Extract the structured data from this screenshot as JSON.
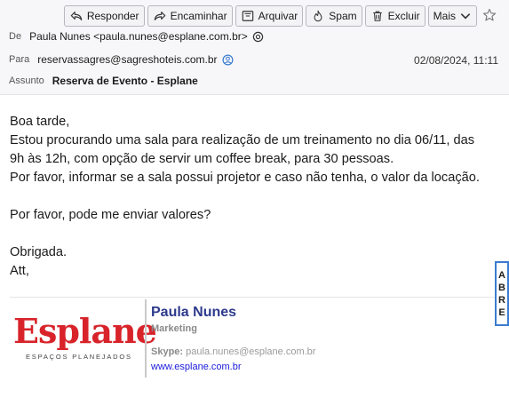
{
  "toolbar": {
    "reply": "Responder",
    "forward": "Encaminhar",
    "archive": "Arquivar",
    "spam": "Spam",
    "delete": "Excluir",
    "more": "Mais"
  },
  "header": {
    "from_label": "De",
    "from_value": "Paula Nunes <paula.nunes@esplane.com.br>",
    "to_label": "Para",
    "to_value": "reservassagres@sagreshoteis.com.br",
    "date": "02/08/2024, 11:11",
    "subject_label": "Assunto",
    "subject_value": "Reserva de Evento - Esplane"
  },
  "body": {
    "line1": "Boa tarde,",
    "line2": "Estou procurando uma sala para realização de um treinamento no dia 06/11, das",
    "line3": "9h às 12h, com opção de servir um coffee break, para 30 pessoas.",
    "line4": "Por favor, informar se a sala possui projetor e caso não tenha, o valor da locação.",
    "line5": "Por favor, pode me enviar valores?",
    "line6": "Obrigada.",
    "line7": "Att,"
  },
  "signature": {
    "logo_word": "Esplane",
    "logo_tagline": "ESPAÇOS PLANEJADOS",
    "name": "Paula Nunes",
    "role": "Marketing",
    "skype_label": "Skype:",
    "skype_value": "paula.nunes@esplane.com.br",
    "website": "www.esplane.com.br"
  },
  "side_tab": {
    "letters": [
      "A",
      "B",
      "R",
      "E"
    ]
  },
  "colors": {
    "brand_red": "#d8232a",
    "name_blue": "#2d3a8c",
    "link_blue": "#1a1adc",
    "side_tab_border": "#3b7bd0"
  },
  "icons": {
    "reply": "reply-icon",
    "forward": "forward-icon",
    "archive": "archive-icon",
    "spam": "spam-flame-icon",
    "delete": "trash-icon",
    "more": "chevron-down-icon",
    "star": "star-icon",
    "from_contact": "contact-at-icon",
    "to_contact": "contact-person-icon"
  }
}
